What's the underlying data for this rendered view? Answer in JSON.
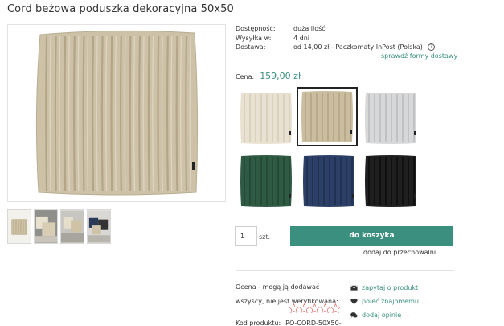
{
  "product": {
    "title": "Cord beżowa poduszka dekoracyjna 50x50",
    "price_label": "Cena:",
    "price_value": "159,00 zł"
  },
  "info": {
    "availability_label": "Dostępność:",
    "availability_value": "duża ilość",
    "shipping_time_label": "Wysyłka w:",
    "shipping_time_value": "4 dni",
    "delivery_label": "Dostawa:",
    "delivery_value": "od 14,00 zł - Paczkomaty InPost (Polska)",
    "shipping_link": "sprawdź formy dostawy"
  },
  "variants": [
    {
      "name": "cream",
      "color": "#e9e2d2",
      "rib": "#d6cdb8",
      "selected": false
    },
    {
      "name": "beige",
      "color": "#cbbd9f",
      "rib": "#b4a584",
      "selected": true
    },
    {
      "name": "grey",
      "color": "#d7d8da",
      "rib": "#bcbdc0",
      "selected": false
    },
    {
      "name": "green",
      "color": "#2f5a43",
      "rib": "#234634",
      "selected": false
    },
    {
      "name": "navy",
      "color": "#2c3f66",
      "rib": "#1f2f50",
      "selected": false
    },
    {
      "name": "black",
      "color": "#1f1f1f",
      "rib": "#0e0e0e",
      "selected": false
    }
  ],
  "cart": {
    "quantity": "1",
    "unit": "szt.",
    "button_label": "do koszyka",
    "storage_link": "dodaj do przechowalni"
  },
  "rating": {
    "text": "Ocena - mogą ją dodawać wszyscy, nie jest weryfikowana:",
    "stars_total": 5
  },
  "code": {
    "label": "Kod produktu:",
    "value": "PO-CORD-50X50-"
  },
  "actions": [
    {
      "icon": "envelope-icon",
      "label": "zapytaj o produkt"
    },
    {
      "icon": "heart-icon",
      "label": "poleć znajomemu"
    },
    {
      "icon": "comments-icon",
      "label": "dodaj opinię"
    }
  ],
  "colors": {
    "accent": "#3a8f7f",
    "star_outline": "#e0706a"
  }
}
